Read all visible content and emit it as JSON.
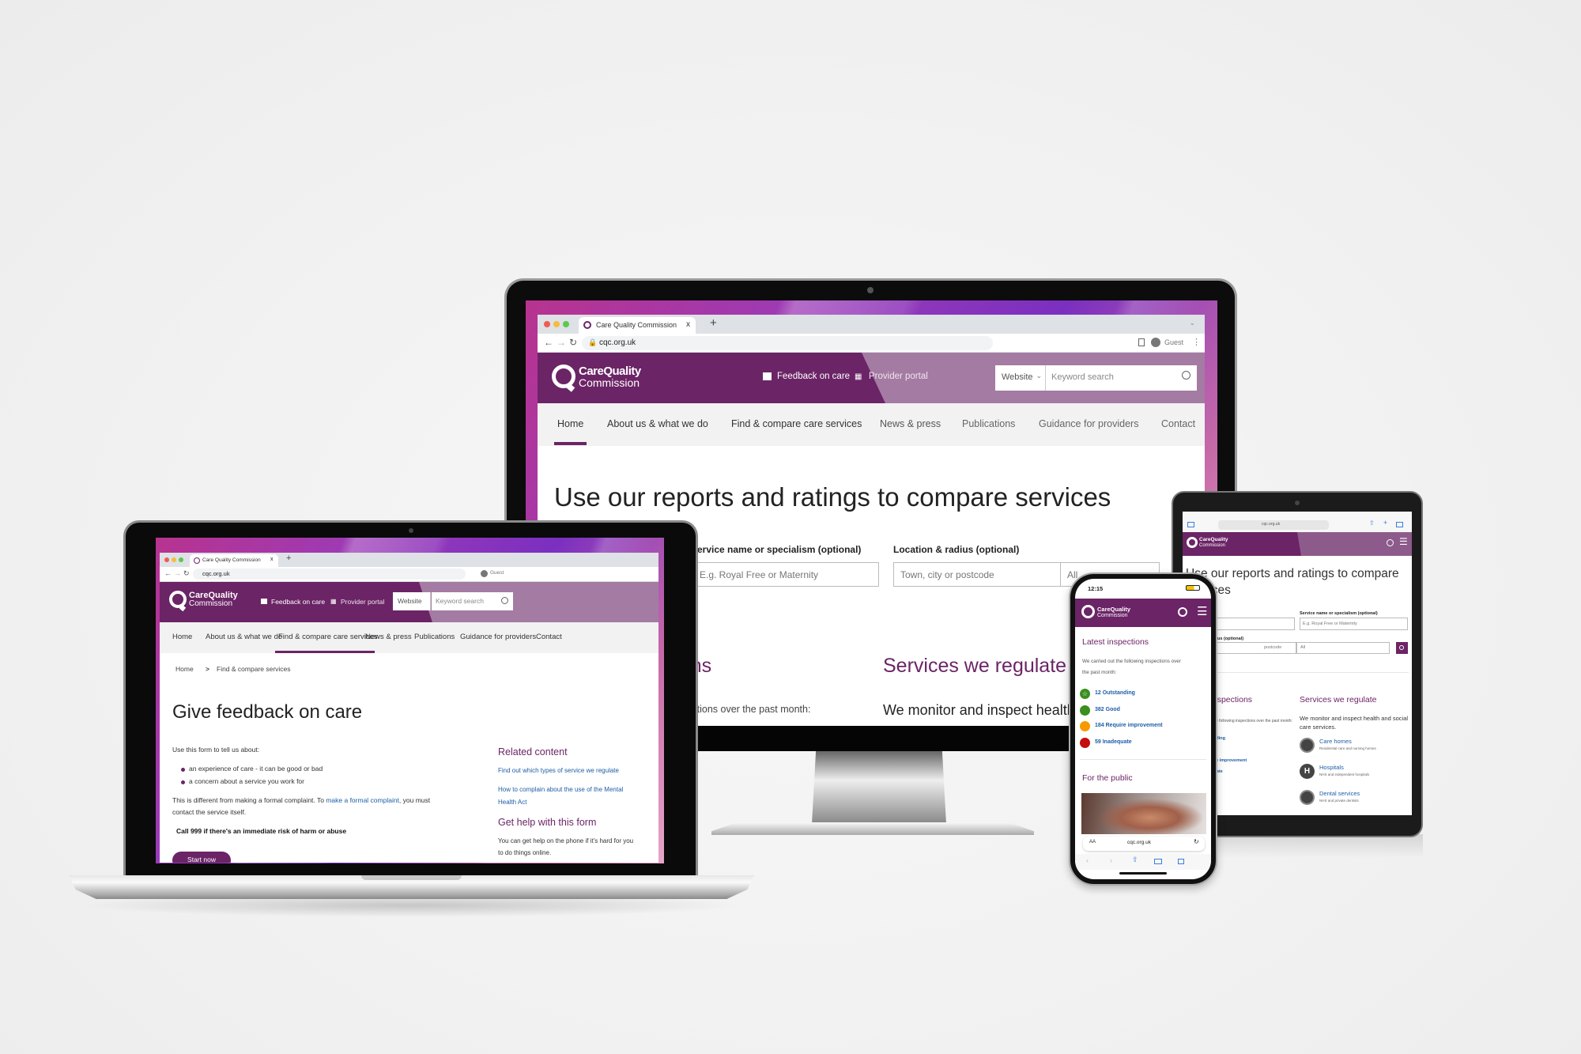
{
  "browser": {
    "tab_title": "Care Quality Commission",
    "close_tab": "x",
    "new_tab": "+",
    "url": "cqc.org.uk",
    "profile": "Guest"
  },
  "brand": {
    "logo_line1": "CareQuality",
    "logo_line2": "Commission",
    "primary": "#6b2466",
    "link": "#1d5ea8"
  },
  "header": {
    "feedback": "Feedback on care",
    "provider_portal": "Provider portal",
    "search_scope": "Website",
    "search_placeholder": "Keyword search"
  },
  "nav": [
    "Home",
    "About us & what we do",
    "Find & compare care services",
    "News & press",
    "Publications",
    "Guidance for providers",
    "Contact"
  ],
  "desktop": {
    "active_nav": "Home",
    "heading": "Use our reports and ratings to compare services",
    "service_label": "Service name or specialism (optional)",
    "service_placeholder": "E.g. Royal Free or Maternity",
    "location_label": "Location & radius (optional)",
    "location_placeholder": "Town, city or postcode",
    "radius_value": "All",
    "latest_title": "Latest inspections",
    "latest_text": "We carried out the following inspections over the past month:",
    "services_title": "Services we regulate",
    "services_text": "We monitor and inspect health and social care services."
  },
  "laptop": {
    "active_nav": "Find & compare care services",
    "breadcrumb": [
      "Home",
      "Find & compare services"
    ],
    "breadcrumb_sep": ">",
    "heading": "Give feedback on care",
    "intro": "Use this form to tell us about:",
    "bullets": [
      "an experience of care - it can be good or bad",
      "a concern about a service you work for"
    ],
    "para_before": "This is different from making a formal complaint. To ",
    "para_link": "make a formal complaint",
    "para_after": ", you must",
    "para_line2": "contact the service itself.",
    "warning": "Call 999 if there's an immediate risk of harm or abuse",
    "start_button": "Start now",
    "related_title": "Related content",
    "related_links": [
      "Find out which types of service we regulate",
      "How to complain about the use of the Mental",
      "Health Act"
    ],
    "help_title": "Get help with this form",
    "help_text": [
      "You can get help on the phone if it's hard for you",
      "to do things online."
    ]
  },
  "tablet": {
    "heading_line1": "Use our reports and ratings to compare",
    "heading_line2": "services",
    "location_label": "Location & radius (optional)",
    "postcode_placeholder": "postcode",
    "services": [
      {
        "name": "Care homes",
        "desc": "Residential care and nursing homes",
        "icon": "home-icon"
      },
      {
        "name": "Hospitals",
        "desc": "NHS and independent hospitals",
        "icon": "hospital-icon"
      },
      {
        "name": "Dental services",
        "desc": "NHS and private dentists",
        "icon": "tooth-icon"
      }
    ]
  },
  "ratings": [
    {
      "label": "12 Outstanding",
      "color": "#3a8f1e"
    },
    {
      "label": "382 Good",
      "color": "#3a8f1e"
    },
    {
      "label": "184 Require improvement",
      "color": "#f59a00"
    },
    {
      "label": "59 Inadequate",
      "color": "#c40d0d"
    }
  ],
  "phone": {
    "time": "12:15",
    "latest_title": "Latest inspections",
    "latest_text": [
      "We carried out the following inspections over",
      "the past month:"
    ],
    "public_title": "For the public",
    "text_size": "AA",
    "url": "cqc.org.uk"
  }
}
